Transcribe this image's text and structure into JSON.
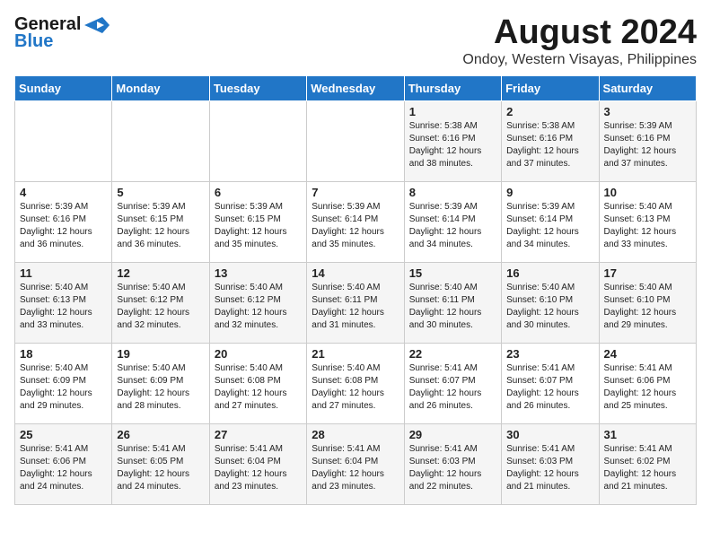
{
  "header": {
    "logo_general": "General",
    "logo_blue": "Blue",
    "month_year": "August 2024",
    "location": "Ondoy, Western Visayas, Philippines"
  },
  "weekdays": [
    "Sunday",
    "Monday",
    "Tuesday",
    "Wednesday",
    "Thursday",
    "Friday",
    "Saturday"
  ],
  "weeks": [
    [
      {
        "day": "",
        "text": ""
      },
      {
        "day": "",
        "text": ""
      },
      {
        "day": "",
        "text": ""
      },
      {
        "day": "",
        "text": ""
      },
      {
        "day": "1",
        "text": "Sunrise: 5:38 AM\nSunset: 6:16 PM\nDaylight: 12 hours\nand 38 minutes."
      },
      {
        "day": "2",
        "text": "Sunrise: 5:38 AM\nSunset: 6:16 PM\nDaylight: 12 hours\nand 37 minutes."
      },
      {
        "day": "3",
        "text": "Sunrise: 5:39 AM\nSunset: 6:16 PM\nDaylight: 12 hours\nand 37 minutes."
      }
    ],
    [
      {
        "day": "4",
        "text": "Sunrise: 5:39 AM\nSunset: 6:16 PM\nDaylight: 12 hours\nand 36 minutes."
      },
      {
        "day": "5",
        "text": "Sunrise: 5:39 AM\nSunset: 6:15 PM\nDaylight: 12 hours\nand 36 minutes."
      },
      {
        "day": "6",
        "text": "Sunrise: 5:39 AM\nSunset: 6:15 PM\nDaylight: 12 hours\nand 35 minutes."
      },
      {
        "day": "7",
        "text": "Sunrise: 5:39 AM\nSunset: 6:14 PM\nDaylight: 12 hours\nand 35 minutes."
      },
      {
        "day": "8",
        "text": "Sunrise: 5:39 AM\nSunset: 6:14 PM\nDaylight: 12 hours\nand 34 minutes."
      },
      {
        "day": "9",
        "text": "Sunrise: 5:39 AM\nSunset: 6:14 PM\nDaylight: 12 hours\nand 34 minutes."
      },
      {
        "day": "10",
        "text": "Sunrise: 5:40 AM\nSunset: 6:13 PM\nDaylight: 12 hours\nand 33 minutes."
      }
    ],
    [
      {
        "day": "11",
        "text": "Sunrise: 5:40 AM\nSunset: 6:13 PM\nDaylight: 12 hours\nand 33 minutes."
      },
      {
        "day": "12",
        "text": "Sunrise: 5:40 AM\nSunset: 6:12 PM\nDaylight: 12 hours\nand 32 minutes."
      },
      {
        "day": "13",
        "text": "Sunrise: 5:40 AM\nSunset: 6:12 PM\nDaylight: 12 hours\nand 32 minutes."
      },
      {
        "day": "14",
        "text": "Sunrise: 5:40 AM\nSunset: 6:11 PM\nDaylight: 12 hours\nand 31 minutes."
      },
      {
        "day": "15",
        "text": "Sunrise: 5:40 AM\nSunset: 6:11 PM\nDaylight: 12 hours\nand 30 minutes."
      },
      {
        "day": "16",
        "text": "Sunrise: 5:40 AM\nSunset: 6:10 PM\nDaylight: 12 hours\nand 30 minutes."
      },
      {
        "day": "17",
        "text": "Sunrise: 5:40 AM\nSunset: 6:10 PM\nDaylight: 12 hours\nand 29 minutes."
      }
    ],
    [
      {
        "day": "18",
        "text": "Sunrise: 5:40 AM\nSunset: 6:09 PM\nDaylight: 12 hours\nand 29 minutes."
      },
      {
        "day": "19",
        "text": "Sunrise: 5:40 AM\nSunset: 6:09 PM\nDaylight: 12 hours\nand 28 minutes."
      },
      {
        "day": "20",
        "text": "Sunrise: 5:40 AM\nSunset: 6:08 PM\nDaylight: 12 hours\nand 27 minutes."
      },
      {
        "day": "21",
        "text": "Sunrise: 5:40 AM\nSunset: 6:08 PM\nDaylight: 12 hours\nand 27 minutes."
      },
      {
        "day": "22",
        "text": "Sunrise: 5:41 AM\nSunset: 6:07 PM\nDaylight: 12 hours\nand 26 minutes."
      },
      {
        "day": "23",
        "text": "Sunrise: 5:41 AM\nSunset: 6:07 PM\nDaylight: 12 hours\nand 26 minutes."
      },
      {
        "day": "24",
        "text": "Sunrise: 5:41 AM\nSunset: 6:06 PM\nDaylight: 12 hours\nand 25 minutes."
      }
    ],
    [
      {
        "day": "25",
        "text": "Sunrise: 5:41 AM\nSunset: 6:06 PM\nDaylight: 12 hours\nand 24 minutes."
      },
      {
        "day": "26",
        "text": "Sunrise: 5:41 AM\nSunset: 6:05 PM\nDaylight: 12 hours\nand 24 minutes."
      },
      {
        "day": "27",
        "text": "Sunrise: 5:41 AM\nSunset: 6:04 PM\nDaylight: 12 hours\nand 23 minutes."
      },
      {
        "day": "28",
        "text": "Sunrise: 5:41 AM\nSunset: 6:04 PM\nDaylight: 12 hours\nand 23 minutes."
      },
      {
        "day": "29",
        "text": "Sunrise: 5:41 AM\nSunset: 6:03 PM\nDaylight: 12 hours\nand 22 minutes."
      },
      {
        "day": "30",
        "text": "Sunrise: 5:41 AM\nSunset: 6:03 PM\nDaylight: 12 hours\nand 21 minutes."
      },
      {
        "day": "31",
        "text": "Sunrise: 5:41 AM\nSunset: 6:02 PM\nDaylight: 12 hours\nand 21 minutes."
      }
    ]
  ]
}
